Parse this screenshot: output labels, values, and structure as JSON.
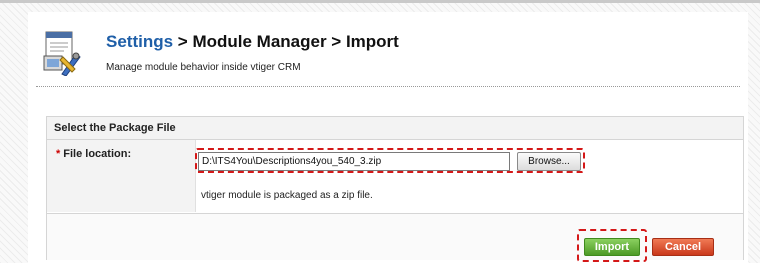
{
  "header": {
    "breadcrumb_root": "Settings",
    "breadcrumb_sep1": " > ",
    "breadcrumb_module_manager": "Module Manager",
    "breadcrumb_sep2": " > ",
    "breadcrumb_current": "Import",
    "subtitle": "Manage module behavior inside vtiger CRM",
    "icon": "settings-tools-icon"
  },
  "panel": {
    "title": "Select the Package File",
    "file_location_label": "File location:",
    "required_marker": "*",
    "file_value": "D:\\ITS4You\\Descriptions4you_540_3.zip",
    "browse_label": "Browse...",
    "hint": "vtiger module is packaged as a zip file."
  },
  "actions": {
    "import_label": "Import",
    "cancel_label": "Cancel"
  },
  "colors": {
    "link": "#1f5fa8",
    "highlight": "#d41818",
    "import_button": "#5aa82e",
    "cancel_button": "#d9482a"
  }
}
